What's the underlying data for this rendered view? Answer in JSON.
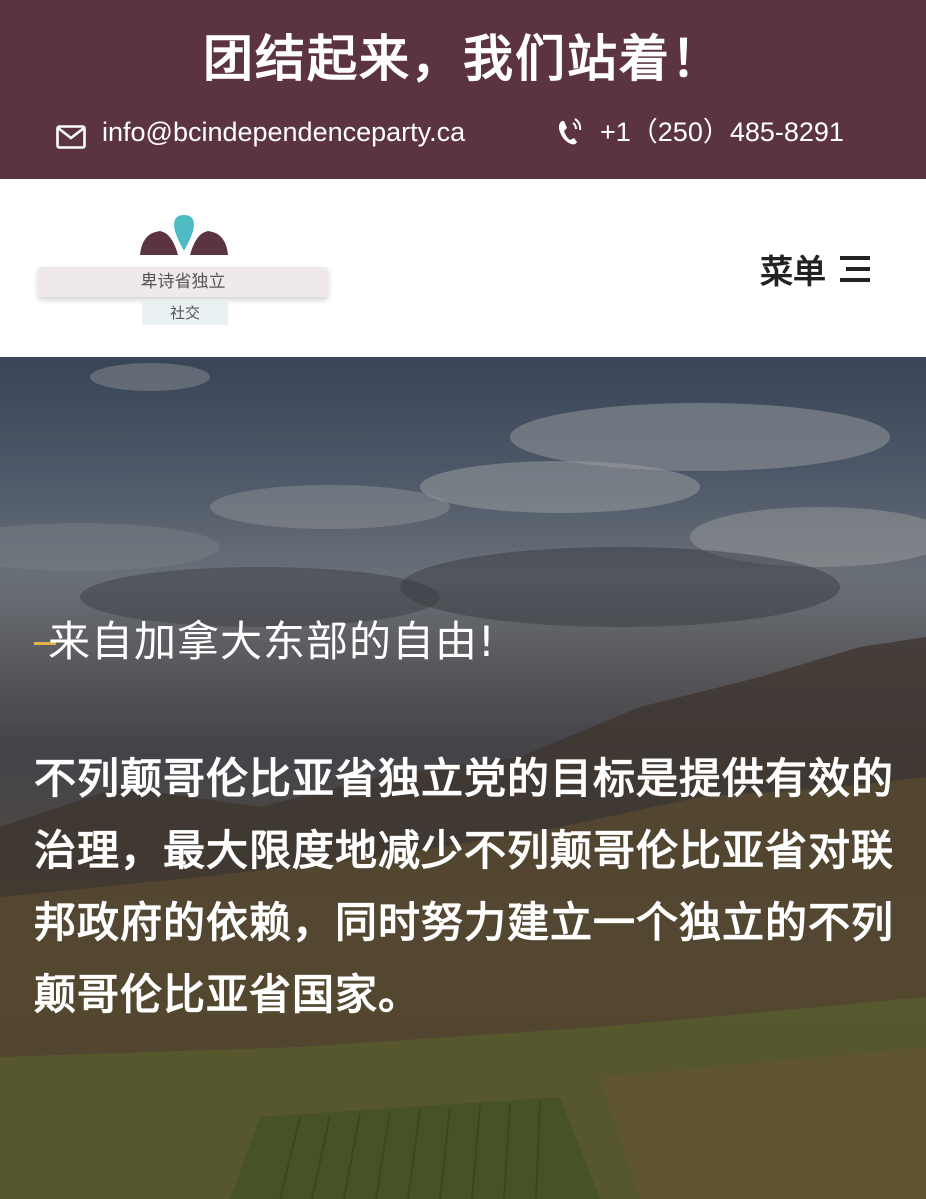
{
  "banner": {
    "title": "团结起来，我们站着！",
    "email": "info@bcindependenceparty.ca",
    "phone": "+1（250）485-8291",
    "email_icon": "envelope-icon",
    "phone_icon": "phone-ringing-icon"
  },
  "header": {
    "logo_text": "卑诗省独立",
    "logo_tag": "社交",
    "menu_label": "菜单",
    "menu_icon": "hamburger-icon"
  },
  "hero": {
    "subtitle": "来自加拿大东部的自由!",
    "body": "不列颠哥伦比亚省独立党的目标是提供有效的治理，最大限度地减少不列颠哥伦比亚省对联邦政府的依赖，同时努力建立一个独立的不列颠哥伦比亚省国家。"
  },
  "colors": {
    "banner_bg": "#5c3342",
    "accent": "#e2b448",
    "logo_teal": "#4fbcc4",
    "logo_maroon": "#5c3342"
  }
}
